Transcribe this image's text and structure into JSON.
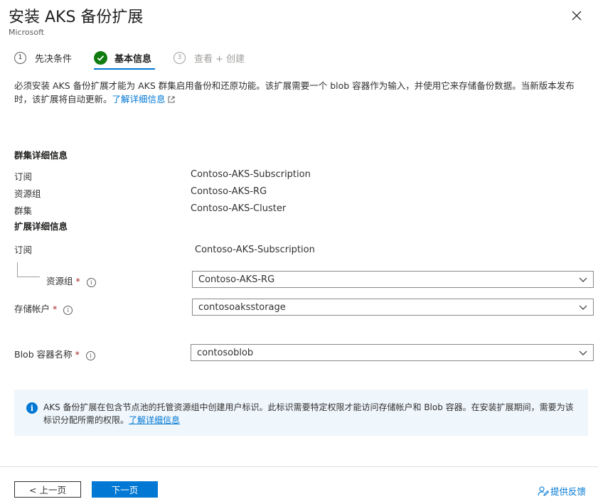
{
  "header": {
    "title": "安装 AKS 备份扩展",
    "publisher": "Microsoft"
  },
  "steps": [
    {
      "number": "1",
      "label": "先决条件",
      "state": "done"
    },
    {
      "label": "基本信息",
      "state": "active"
    },
    {
      "number": "3",
      "label": "查看 + 创建",
      "state": "upcoming"
    }
  ],
  "description": {
    "text": "必须安装 AKS 备份扩展才能为 AKS 群集启用备份和还原功能。该扩展需要一个 blob 容器作为输入，并使用它来存储备份数据。当新版本发布时，该扩展将自动更新。",
    "link": "了解详细信息"
  },
  "cluster_details": {
    "heading": "群集详细信息",
    "rows": [
      {
        "label": "订阅",
        "value": "Contoso-AKS-Subscription"
      },
      {
        "label": "资源组",
        "value": "Contoso-AKS-RG"
      },
      {
        "label": "群集",
        "value": "Contoso-AKS-Cluster"
      }
    ]
  },
  "extension_details": {
    "heading": "扩展详细信息",
    "subscription_label": "订阅",
    "subscription_value": "Contoso-AKS-Subscription",
    "resource_group": {
      "label": "资源组",
      "required": "*",
      "value": "Contoso-AKS-RG"
    },
    "storage_account": {
      "label": "存储帐户",
      "required": "*",
      "value": "contosoaksstorage"
    },
    "blob_container": {
      "label": "Blob 容器名称",
      "required": "*",
      "value": "contosoblob"
    }
  },
  "info_box": {
    "text": "AKS 备份扩展在包含节点池的托管资源组中创建用户标识。此标识需要特定权限才能访问存储帐户和 Blob 容器。在安装扩展期间，需要为该标识分配所需的权限。",
    "link": "了解详细信息"
  },
  "footer": {
    "prev_label": "< 上一页",
    "next_label": "下一页",
    "feedback_label": "提供反馈"
  },
  "colors": {
    "accent": "#0078d4",
    "success": "#107c10",
    "required": "#a4262c",
    "info_background": "#eff6fc"
  }
}
